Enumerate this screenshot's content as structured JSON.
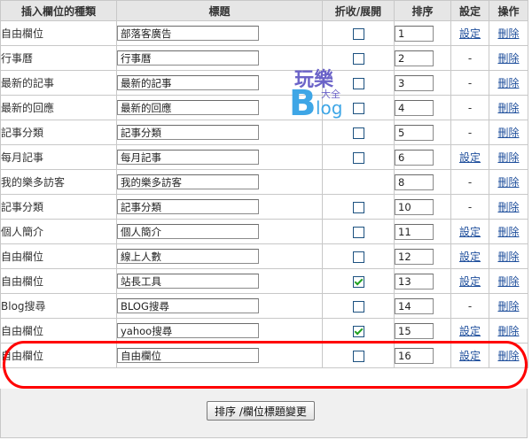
{
  "headers": {
    "type": "插入欄位的種類",
    "title": "標題",
    "collapse": "折收/展開",
    "sort": "排序",
    "setting": "設定",
    "action": "操作"
  },
  "rows": [
    {
      "type": "自由欄位",
      "title": "部落客廣告",
      "has_checkbox": true,
      "checked": false,
      "sort": "1",
      "setting": "設定",
      "setting_link": true,
      "action": "刪除"
    },
    {
      "type": "行事曆",
      "title": "行事曆",
      "has_checkbox": true,
      "checked": false,
      "sort": "2",
      "setting": "-",
      "setting_link": false,
      "action": "刪除"
    },
    {
      "type": "最新的記事",
      "title": "最新的記事",
      "has_checkbox": true,
      "checked": false,
      "sort": "3",
      "setting": "-",
      "setting_link": false,
      "action": "刪除"
    },
    {
      "type": "最新的回應",
      "title": "最新的回應",
      "has_checkbox": true,
      "checked": false,
      "sort": "4",
      "setting": "-",
      "setting_link": false,
      "action": "刪除"
    },
    {
      "type": "記事分類",
      "title": "記事分類",
      "has_checkbox": true,
      "checked": false,
      "sort": "5",
      "setting": "-",
      "setting_link": false,
      "action": "刪除"
    },
    {
      "type": "每月記事",
      "title": "每月記事",
      "has_checkbox": true,
      "checked": false,
      "sort": "6",
      "setting": "設定",
      "setting_link": true,
      "action": "刪除"
    },
    {
      "type": "我的樂多訪客",
      "title": "我的樂多訪客",
      "has_checkbox": false,
      "checked": false,
      "sort": "8",
      "setting": "-",
      "setting_link": false,
      "action": "刪除"
    },
    {
      "type": "記事分類",
      "title": "記事分類",
      "has_checkbox": true,
      "checked": false,
      "sort": "10",
      "setting": "-",
      "setting_link": false,
      "action": "刪除"
    },
    {
      "type": "個人簡介",
      "title": "個人簡介",
      "has_checkbox": true,
      "checked": false,
      "sort": "11",
      "setting": "設定",
      "setting_link": true,
      "action": "刪除"
    },
    {
      "type": "自由欄位",
      "title": "線上人數",
      "has_checkbox": true,
      "checked": false,
      "sort": "12",
      "setting": "設定",
      "setting_link": true,
      "action": "刪除"
    },
    {
      "type": "自由欄位",
      "title": "站長工具",
      "has_checkbox": true,
      "checked": true,
      "sort": "13",
      "setting": "設定",
      "setting_link": true,
      "action": "刪除"
    },
    {
      "type": "Blog搜尋",
      "title": "BLOG搜尋",
      "has_checkbox": true,
      "checked": false,
      "sort": "14",
      "setting": "-",
      "setting_link": false,
      "action": "刪除"
    },
    {
      "type": "自由欄位",
      "title": "yahoo搜尋",
      "has_checkbox": true,
      "checked": true,
      "sort": "15",
      "setting": "設定",
      "setting_link": true,
      "action": "刪除"
    },
    {
      "type": "自由欄位",
      "title": "自由欄位",
      "has_checkbox": true,
      "checked": false,
      "sort": "16",
      "setting": "設定",
      "setting_link": true,
      "action": "刪除"
    }
  ],
  "submit_label": "排序 /欄位標題變更",
  "watermark": {
    "line1": "玩樂",
    "line2": "大全",
    "big": "B",
    "small": "log"
  },
  "colors": {
    "link": "#1f4f9c",
    "header_bg": "#e6e6e6",
    "highlight": "#ff0000",
    "check": "#21a121"
  }
}
